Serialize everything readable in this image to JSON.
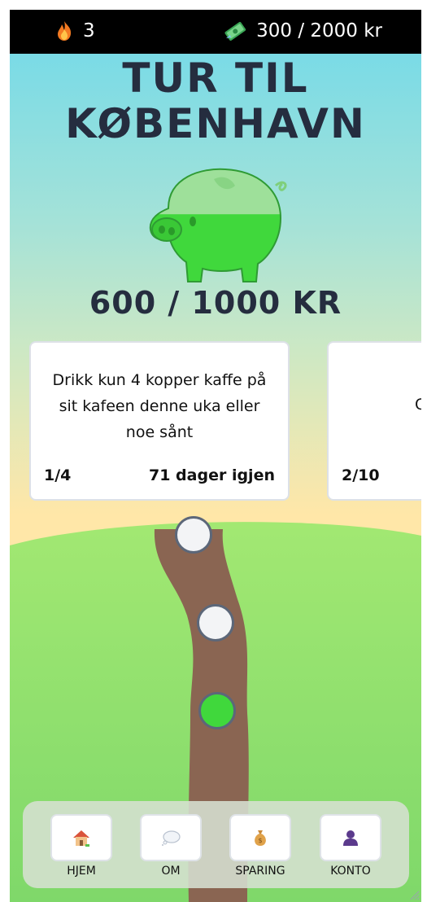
{
  "topbar": {
    "streak_icon": "flame-icon",
    "streak_count": "3",
    "money_icon": "money-icon",
    "total_savings": "300 / 2000 kr"
  },
  "goal": {
    "title_line1": "TUR TIL",
    "title_line2": "KØBENHAVN",
    "amount_text": "600 / 1000 KR",
    "progress_fraction": 0.6,
    "icon": "piggy-bank-icon"
  },
  "challenges": [
    {
      "text": "Drikk kun 4 kopper kaffe på sit kafeen denne uka eller noe sånt",
      "progress": "1/4",
      "days_left": "71 dager igjen"
    },
    {
      "text": "C",
      "progress": "2/10",
      "days_left": ""
    }
  ],
  "path": {
    "nodes": [
      {
        "state": "open"
      },
      {
        "state": "open"
      },
      {
        "state": "completed"
      }
    ]
  },
  "nav": [
    {
      "label": "HJEM",
      "icon": "house-icon"
    },
    {
      "label": "OM",
      "icon": "speech-bubble-icon"
    },
    {
      "label": "SPARING",
      "icon": "money-bag-icon"
    },
    {
      "label": "KONTO",
      "icon": "user-icon"
    }
  ],
  "colors": {
    "accent_green": "#40d83c",
    "title_text": "#252d3f",
    "path_brown": "#8a6552",
    "topbar": "#000000"
  }
}
